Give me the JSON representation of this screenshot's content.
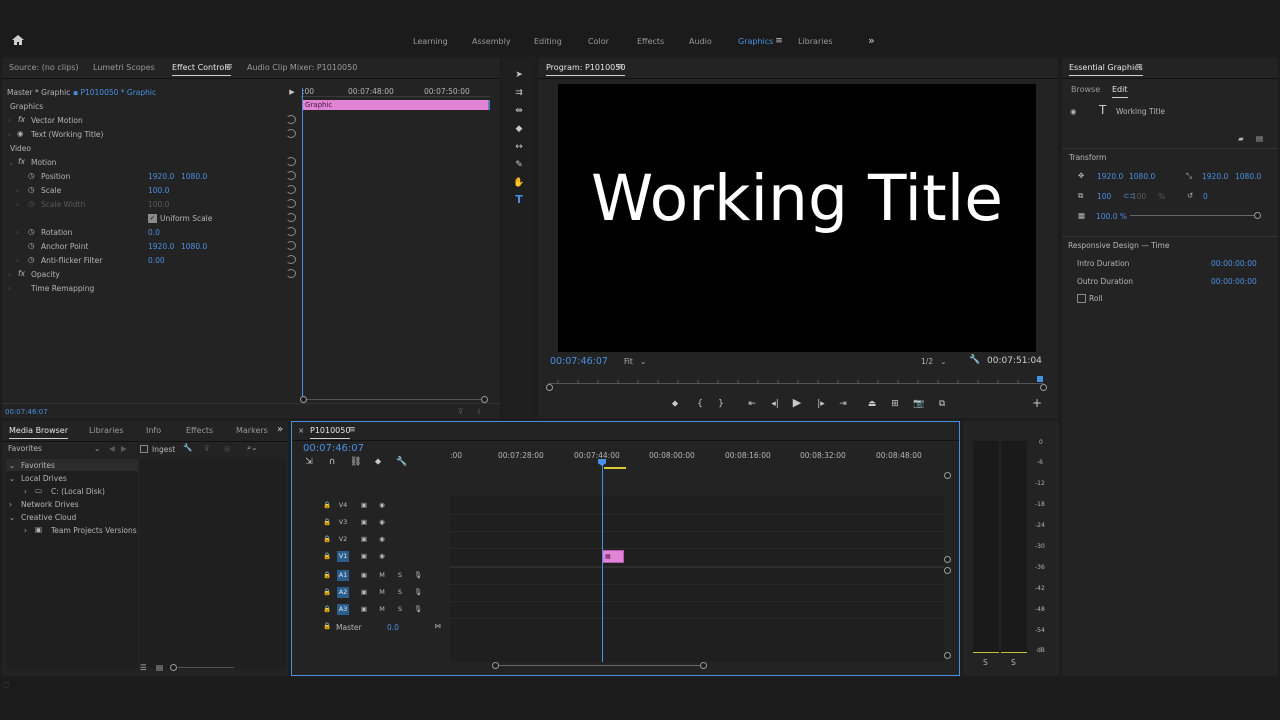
{
  "workspaces": {
    "items": [
      "Learning",
      "Assembly",
      "Editing",
      "Color",
      "Effects",
      "Audio",
      "Graphics",
      "Libraries"
    ],
    "active": "Graphics",
    "overflow": "»"
  },
  "source_panel": {
    "tabs": [
      "Source: (no clips)",
      "Lumetri Scopes",
      "Effect Controls",
      "Audio Clip Mixer: P1010050"
    ],
    "master_label": "Master * Graphic",
    "clip_label": "P1010050 * Graphic",
    "ruler_times": [
      ":00",
      "00:07:48:00",
      "00:07:50:00"
    ],
    "clip_bar_label": "Graphic",
    "sections": {
      "graphics": "Graphics",
      "video": "Video"
    },
    "effects": {
      "vector_motion": "Vector Motion",
      "text": "Text (Working Title)",
      "motion": "Motion",
      "position": {
        "label": "Position",
        "x": "1920.0",
        "y": "1080.0"
      },
      "scale": {
        "label": "Scale",
        "value": "100.0"
      },
      "scale_width": {
        "label": "Scale Width",
        "value": "100.0"
      },
      "uniform_scale": "Uniform Scale",
      "rotation": {
        "label": "Rotation",
        "value": "0.0"
      },
      "anchor_point": {
        "label": "Anchor Point",
        "x": "1920.0",
        "y": "1080.0"
      },
      "anti_flicker": {
        "label": "Anti-flicker Filter",
        "value": "0.00"
      },
      "opacity": "Opacity",
      "time_remapping": "Time Remapping"
    },
    "timecode": "00:07:46:07"
  },
  "program_monitor": {
    "title": "Program: P1010050",
    "title_text": "Working Title",
    "timecode": "00:07:46:07",
    "fit": "Fit",
    "resolution": "1/2",
    "duration": "00:07:51:04"
  },
  "essential_graphics": {
    "title": "Essential Graphics",
    "tabs": [
      "Browse",
      "Edit"
    ],
    "layer_name": "Working Title",
    "transform_label": "Transform",
    "position": {
      "x": "1920.0",
      "y": "1080.0"
    },
    "anchor": {
      "x": "1920.0",
      "y": "1080.0"
    },
    "scale_w": "100",
    "scale_h": "100",
    "percent": "%",
    "rotation": "0",
    "opacity": "100.0 %",
    "responsive_label": "Responsive Design — Time",
    "intro_label": "Intro Duration",
    "intro_value": "00:00:00:00",
    "outro_label": "Outro Duration",
    "outro_value": "00:00:00:00",
    "roll_label": "Roll"
  },
  "media_browser": {
    "tabs": [
      "Media Browser",
      "Libraries",
      "Info",
      "Effects",
      "Markers"
    ],
    "location": "Favorites",
    "ingest": "Ingest",
    "tree": [
      {
        "label": "Favorites",
        "indent": 0
      },
      {
        "label": "Local Drives",
        "indent": 0
      },
      {
        "label": "C: (Local Disk)",
        "indent": 2
      },
      {
        "label": "Network Drives",
        "indent": 0
      },
      {
        "label": "Creative Cloud",
        "indent": 0
      },
      {
        "label": "Team Projects Versions",
        "indent": 2
      }
    ]
  },
  "timeline": {
    "sequence": "P1010050",
    "timecode": "00:07:46:07",
    "ruler": [
      ":00",
      "00:07:28:00",
      "00:07:44:00",
      "00:08:00:00",
      "00:08:16:00",
      "00:08:32:00",
      "00:08:48:00"
    ],
    "video_tracks": [
      "V4",
      "V3",
      "V2",
      "V1"
    ],
    "audio_tracks": [
      "A1",
      "A2",
      "A3"
    ],
    "m_label": "M",
    "s_label": "S",
    "master_label": "Master",
    "master_value": "0.0"
  },
  "audio_meter": {
    "scale": [
      "0",
      "-6",
      "-12",
      "-18",
      "-24",
      "-30",
      "-36",
      "-42",
      "-48",
      "-54",
      "dB"
    ],
    "solo_labels": [
      "S",
      "S"
    ]
  },
  "colors": {
    "accent": "#4a90e2",
    "clip_pink": "#e184d6",
    "panel": "#232323"
  }
}
